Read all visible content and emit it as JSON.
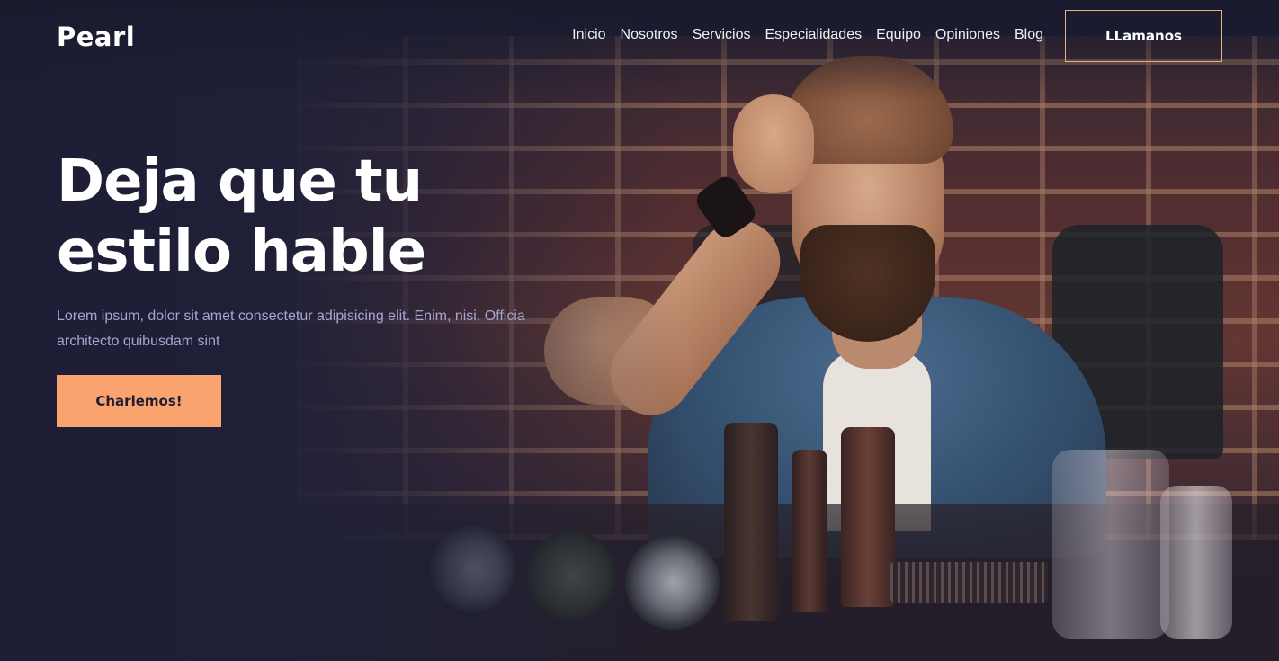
{
  "brand": {
    "logo": "Pearl"
  },
  "nav": {
    "items": [
      {
        "label": "Inicio"
      },
      {
        "label": "Nosotros"
      },
      {
        "label": "Servicios"
      },
      {
        "label": "Especialidades"
      },
      {
        "label": "Equipo"
      },
      {
        "label": "Opiniones"
      },
      {
        "label": "Blog"
      }
    ],
    "call_button": "LLamanos"
  },
  "hero": {
    "headline_line1": "Deja que tu",
    "headline_line2": "estilo hable",
    "subtext": "Lorem ipsum, dolor sit amet consectetur adipisicing elit. Enim, nisi. Officia architecto quibusdam sint",
    "cta_button": "Charlemos!"
  },
  "colors": {
    "background": "#1c1d33",
    "accent": "#fba36e",
    "outline_accent": "#e6b07f",
    "subtext": "#a7a5cf",
    "text": "#ffffff"
  }
}
